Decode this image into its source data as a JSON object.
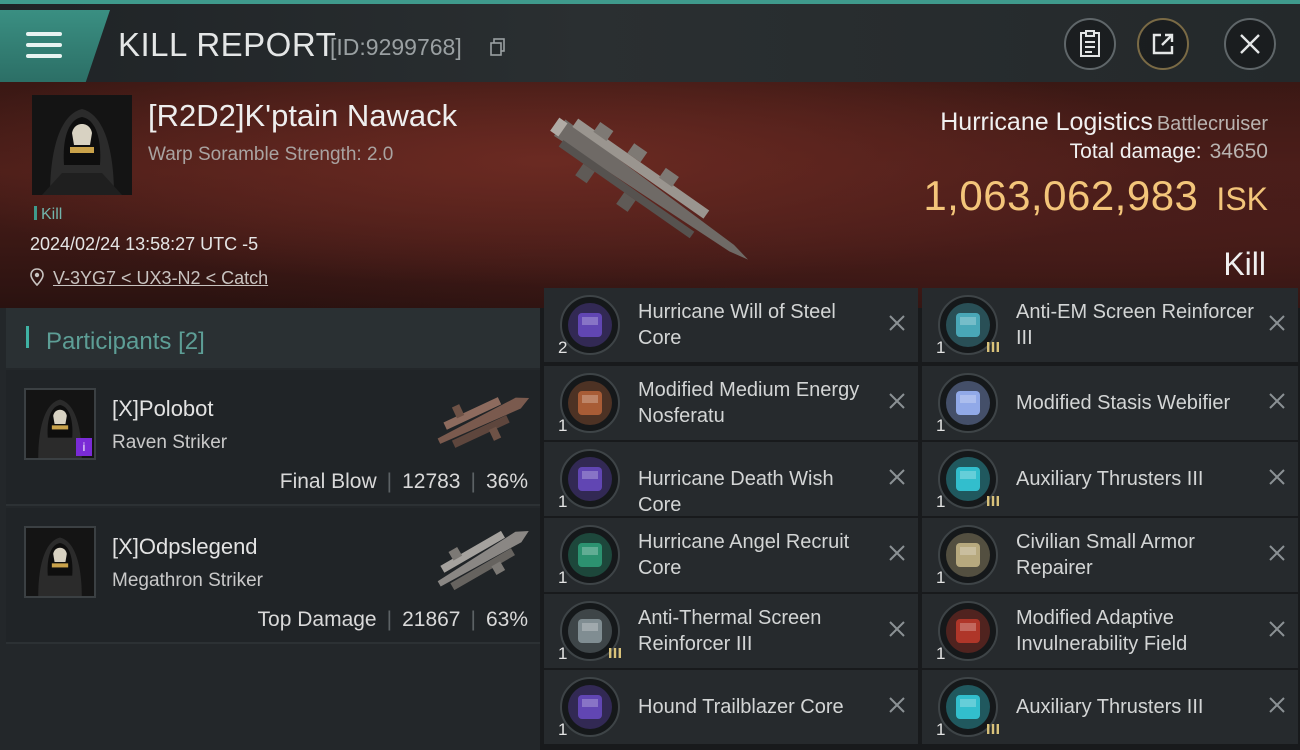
{
  "header": {
    "title": "KILL REPORT",
    "report_id": "[ID:9299768]"
  },
  "victim": {
    "pilot": "[R2D2]K'ptain Nawack",
    "warp_scramble": "Warp Soramble Strength: 2.0",
    "kill_tag": "Kill",
    "datetime": "2024/02/24 13:58:27 UTC -5",
    "location": "V-3YG7 < UX3-N2 < Catch",
    "ship_name": "Hurricane Logistics",
    "ship_class": "Battlecruiser",
    "total_damage_label": "Total damage:",
    "total_damage": "34650",
    "isk_value": "1,063,062,983",
    "isk_unit": "ISK",
    "result": "Kill"
  },
  "participants": {
    "title": "Participants",
    "count": "[2]",
    "items": [
      {
        "name": "[X]Polobot",
        "ship": "Raven Striker",
        "role": "Final Blow",
        "damage": "12783",
        "percent": "36%"
      },
      {
        "name": "[X]Odpslegend",
        "ship": "Megathron Striker",
        "role": "Top Damage",
        "damage": "21867",
        "percent": "63%"
      }
    ]
  },
  "modules": {
    "left": [
      {
        "name": "Hurricane Will of Steel Core",
        "qty": "2",
        "icon": "core-icon",
        "color": "#6a4bc4"
      },
      {
        "name": "Modified Medium Energy Nosferatu",
        "qty": "1",
        "icon": "nosferatu-icon",
        "color": "#b8643a"
      },
      {
        "name": "Hurricane Death Wish Core",
        "qty": "1",
        "icon": "core-icon",
        "color": "#6a4bc4"
      },
      {
        "name": "Hurricane Angel Recruit Core",
        "qty": "1",
        "icon": "core-icon",
        "color": "#2fa07a"
      },
      {
        "name": "Anti-Thermal Screen Reinforcer III",
        "qty": "1",
        "icon": "shield-reinforcer-icon",
        "color": "#8c9aa0"
      },
      {
        "name": "Hound Trailblazer Core",
        "qty": "1",
        "icon": "core-icon",
        "color": "#6a4bc4"
      }
    ],
    "right": [
      {
        "name": "Anti-EM Screen Reinforcer III",
        "qty": "1",
        "icon": "shield-reinforcer-icon",
        "color": "#4fb6c8"
      },
      {
        "name": "Modified Stasis Webifier",
        "qty": "1",
        "icon": "webifier-icon",
        "color": "#9fb8ff"
      },
      {
        "name": "Auxiliary Thrusters III",
        "qty": "1",
        "icon": "thruster-icon",
        "color": "#36d0e0"
      },
      {
        "name": "Civilian Small Armor Repairer",
        "qty": "1",
        "icon": "armor-repairer-icon",
        "color": "#c9b88a"
      },
      {
        "name": "Modified Adaptive Invulnerability Field",
        "qty": "1",
        "icon": "invulnerability-field-icon",
        "color": "#c0392b"
      },
      {
        "name": "Auxiliary Thrusters III",
        "qty": "1",
        "icon": "thruster-icon",
        "color": "#36d0e0"
      }
    ]
  }
}
